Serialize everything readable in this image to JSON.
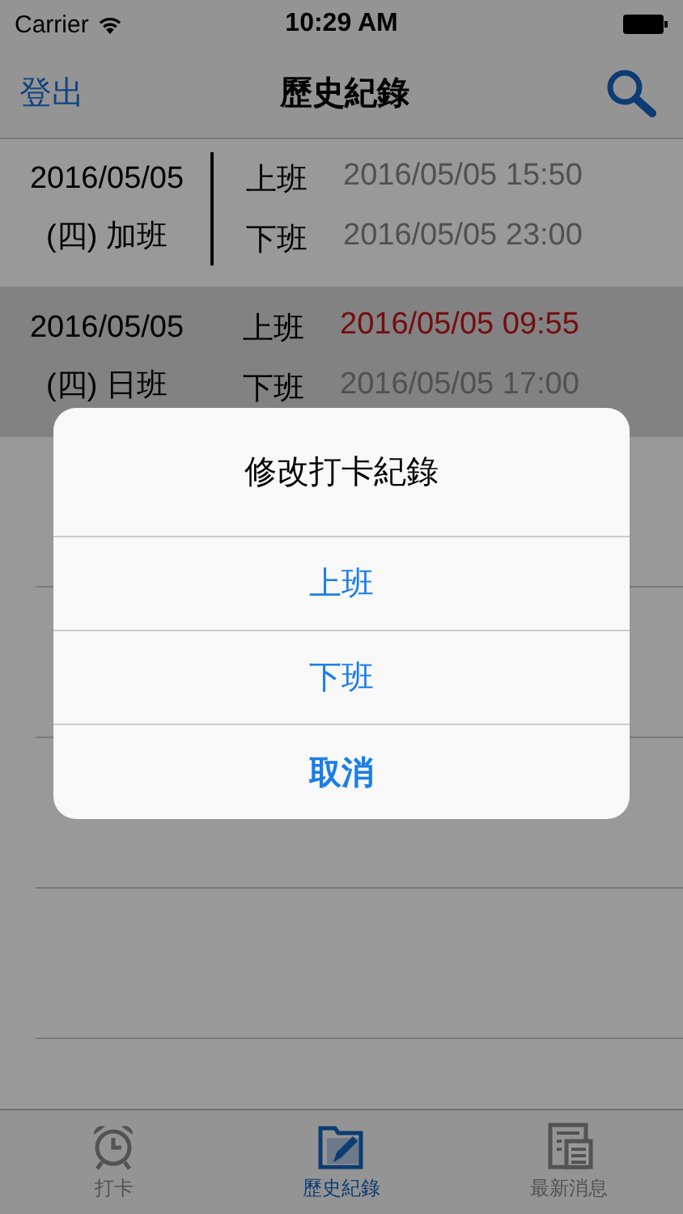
{
  "status_bar": {
    "carrier": "Carrier",
    "time": "10:29 AM"
  },
  "nav_bar": {
    "left_button": "登出",
    "title": "歷史紀錄"
  },
  "records": [
    {
      "date": "2016/05/05",
      "day": "(四) 加班",
      "selected": false,
      "punches": [
        {
          "label": "上班",
          "time": "2016/05/05 15:50",
          "late": false
        },
        {
          "label": "下班",
          "time": "2016/05/05 23:00",
          "late": false
        }
      ]
    },
    {
      "date": "2016/05/05",
      "day": "(四) 日班",
      "selected": true,
      "punches": [
        {
          "label": "上班",
          "time": "2016/05/05 09:55",
          "late": true
        },
        {
          "label": "下班",
          "time": "2016/05/05 17:00",
          "late": false
        }
      ]
    }
  ],
  "dialog": {
    "title": "修改打卡紀錄",
    "actions": [
      {
        "label": "上班",
        "kind": "default"
      },
      {
        "label": "下班",
        "kind": "default"
      },
      {
        "label": "取消",
        "kind": "cancel"
      }
    ]
  },
  "tab_bar": [
    {
      "label": "打卡",
      "kind": "clock",
      "selected": false
    },
    {
      "label": "歷史紀錄",
      "kind": "folder",
      "selected": true
    },
    {
      "label": "最新消息",
      "kind": "news",
      "selected": false
    }
  ]
}
